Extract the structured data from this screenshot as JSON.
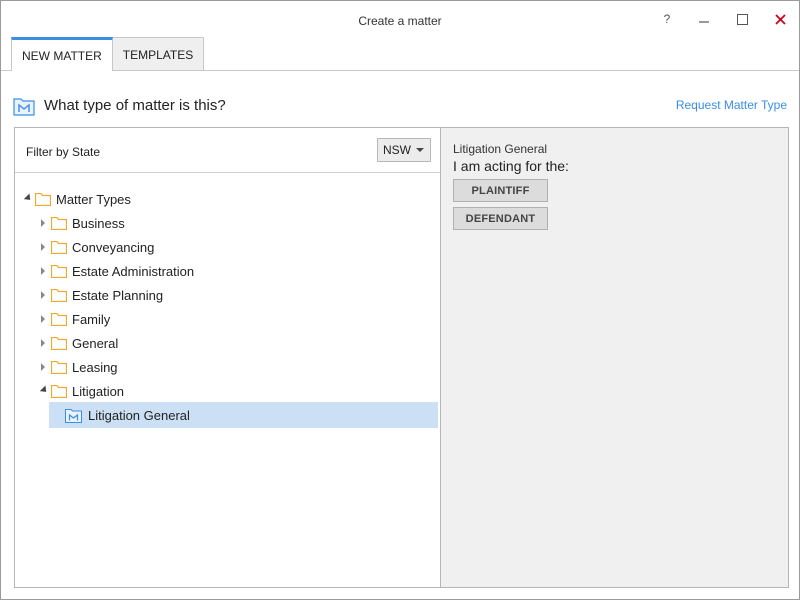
{
  "window": {
    "title": "Create a matter",
    "help_label": "?",
    "minimize_label": "—",
    "maximize_label": "☐",
    "close_label": "✕"
  },
  "tabs": [
    {
      "label": "NEW MATTER",
      "active": true
    },
    {
      "label": "TEMPLATES",
      "active": false
    }
  ],
  "header": {
    "title": "What type of matter is this?",
    "link": "Request Matter Type",
    "icon": "matter-icon"
  },
  "filter": {
    "label": "Filter by State",
    "selected": "NSW"
  },
  "tree": {
    "root": {
      "label": "Matter Types",
      "expanded": true
    },
    "children": [
      {
        "label": "Business",
        "expanded": false
      },
      {
        "label": "Conveyancing",
        "expanded": false
      },
      {
        "label": "Estate Administration",
        "expanded": false
      },
      {
        "label": "Estate Planning",
        "expanded": false
      },
      {
        "label": "Family",
        "expanded": false
      },
      {
        "label": "General",
        "expanded": false
      },
      {
        "label": "Leasing",
        "expanded": false
      },
      {
        "label": "Litigation",
        "expanded": true
      }
    ],
    "selected_leaf": {
      "label": "Litigation General",
      "icon": "matter-icon"
    }
  },
  "details": {
    "subtitle": "Litigation General",
    "prompt": "I am acting for the:",
    "buttons": [
      "PLAINTIFF",
      "DEFENDANT"
    ]
  },
  "colors": {
    "accent": "#3a8ee6",
    "selection": "#cce0f5",
    "folder": "#f0a830",
    "close": "#d0021b",
    "panel": "#f0f0f0"
  }
}
